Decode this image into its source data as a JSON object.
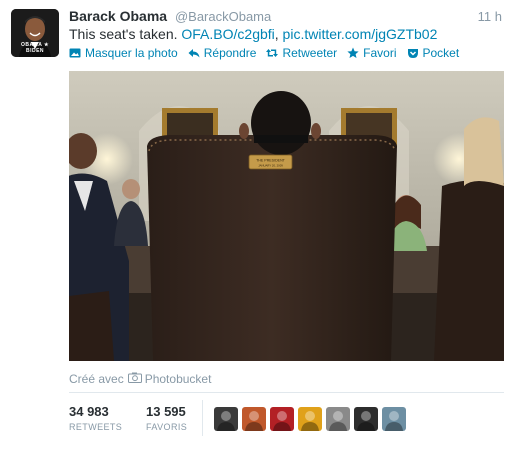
{
  "author": {
    "name": "Barack Obama",
    "handle": "@BarackObama",
    "time": "11 h",
    "avatar_caption": "OBAMA ★ BIDEN"
  },
  "tweet": {
    "text": "This seat's taken.",
    "link1": "OFA.BO/c2gbfi",
    "separator": ",",
    "link2": "pic.twitter.com/jgGZTb02"
  },
  "actions": [
    {
      "label": "Masquer la photo",
      "icon": "photo-icon"
    },
    {
      "label": "Répondre",
      "icon": "reply-icon"
    },
    {
      "label": "Retweeter",
      "icon": "retweet-icon"
    },
    {
      "label": "Favori",
      "icon": "star-icon"
    },
    {
      "label": "Pocket",
      "icon": "pocket-icon"
    }
  ],
  "photo": {
    "plaque_line1": "THE PRESIDENT",
    "plaque_line2": "JANUARY 20, 2009"
  },
  "credit": {
    "prefix": "Créé avec",
    "service": "Photobucket"
  },
  "stats": {
    "retweets": {
      "value": "34 983",
      "label": "RETWEETS"
    },
    "favorites": {
      "value": "13 595",
      "label": "FAVORIS"
    }
  },
  "favoriters": [
    {
      "color": "#3a3a3a"
    },
    {
      "color": "#c0582b"
    },
    {
      "color": "#b32025"
    },
    {
      "color": "#e0a11a"
    },
    {
      "color": "#8a8a8a"
    },
    {
      "color": "#2d2d2d"
    },
    {
      "color": "#6d8fa3"
    }
  ],
  "colors": {
    "link": "#0084b4",
    "text": "#292f33",
    "muted": "#8899a6"
  }
}
